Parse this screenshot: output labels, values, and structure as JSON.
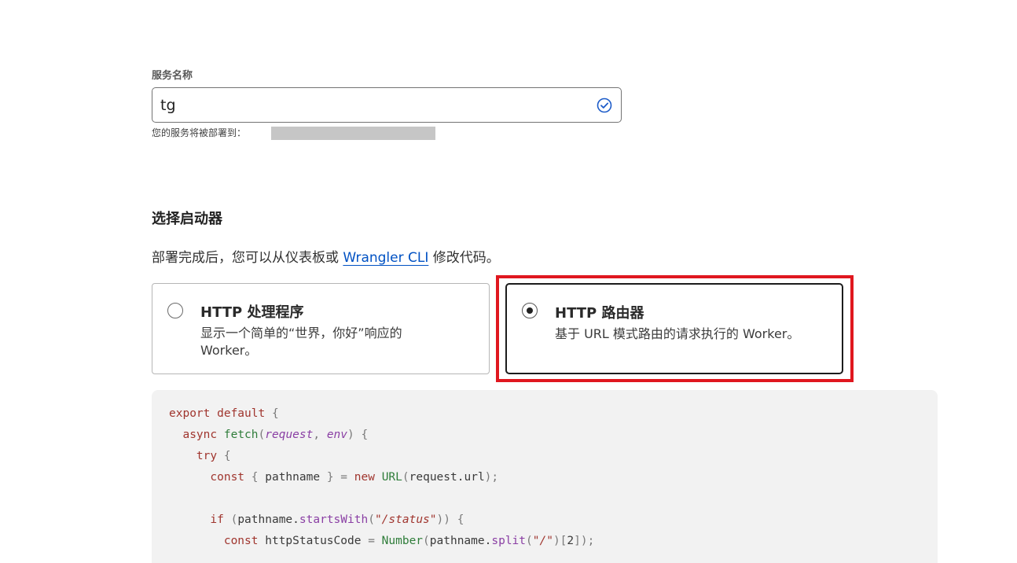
{
  "service": {
    "label": "服务名称",
    "value": "tg",
    "deploy_hint": "您的服务将被部署到："
  },
  "starter": {
    "heading": "选择启动器",
    "desc_before": "部署完成后，您可以从仪表板或 ",
    "desc_link": "Wrangler CLI",
    "desc_after": " 修改代码。",
    "options": [
      {
        "title": "HTTP 处理程序",
        "description": "显示一个简单的“世界，你好”响应的 Worker。",
        "selected": false
      },
      {
        "title": "HTTP 路由器",
        "description": "基于 URL 模式路由的请求执行的 Worker。",
        "selected": true
      }
    ]
  },
  "code": {
    "l1_kw": "export default",
    "l1_punc": " {",
    "l2_kw": "async",
    "l2_fn": "fetch",
    "l2_p1": "request",
    "l2_p2": "env",
    "l3_kw": "try",
    "l4_kw": "const",
    "l4_var": " pathname ",
    "l4_new": "new",
    "l4_fn": "URL",
    "l4_arg": "request.url",
    "l6_kw": "if",
    "l6_obj": "pathname.",
    "l6_fn": "startsWith",
    "l6_str": "\"/status\"",
    "l7_kw": "const",
    "l7_var": " httpStatusCode ",
    "l7_fn": "Number",
    "l7_obj": "pathname.",
    "l7_fn2": "split",
    "l7_str": "\"/\"",
    "l7_idx": "2"
  },
  "colors": {
    "highlight": "#e0171f",
    "link": "#0051c3",
    "check": "#1d5cc9"
  }
}
